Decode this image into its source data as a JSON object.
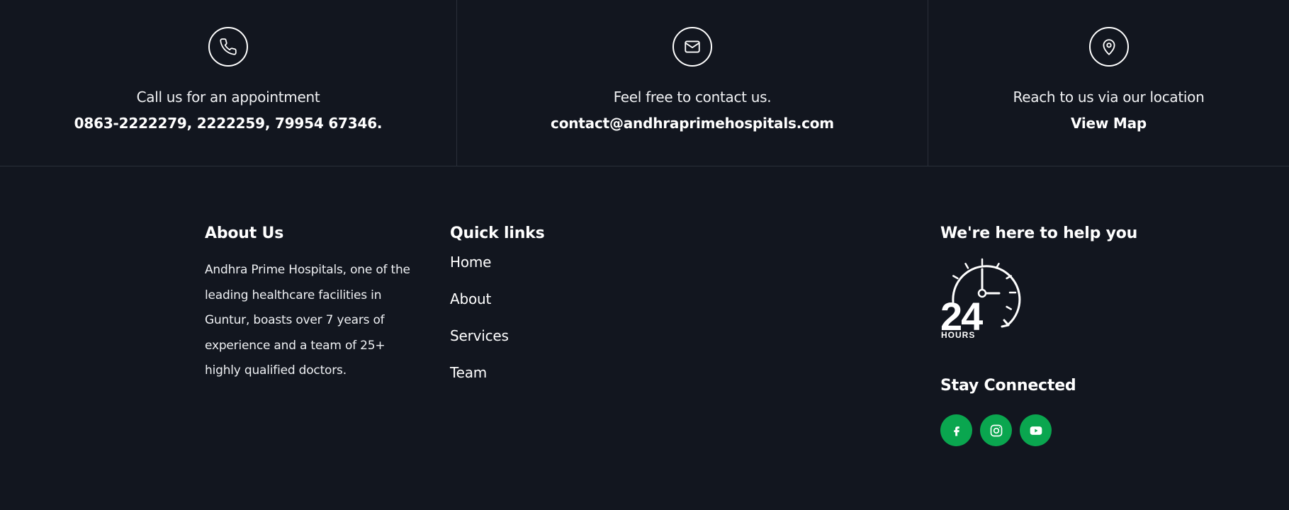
{
  "contact_bar": {
    "phone": {
      "icon": "phone-icon",
      "caption": "Call us for an appointment",
      "value": "0863-2222279, 2222259, 79954 67346."
    },
    "email": {
      "icon": "envelope-icon",
      "caption": "Feel free to contact us.",
      "value": "contact@andhraprimehospitals.com"
    },
    "location": {
      "icon": "map-pin-icon",
      "caption": "Reach to us via our location",
      "value": "View Map"
    }
  },
  "about": {
    "heading": "About Us",
    "text": "Andhra Prime Hospitals, one of the leading healthcare facilities in Guntur, boasts over 7 years of experience and a team of 25+ highly qualified doctors."
  },
  "quick_links": {
    "heading": "Quick links",
    "items": [
      {
        "label": "Home"
      },
      {
        "label": "About"
      },
      {
        "label": "Services"
      },
      {
        "label": "Team"
      }
    ]
  },
  "help": {
    "heading": "We're here to help you",
    "clock_number": "24",
    "clock_caption": "HOURS",
    "icon": "24-hours-clock-icon"
  },
  "social": {
    "heading": "Stay Connected",
    "icons": [
      "facebook-icon",
      "instagram-icon",
      "youtube-icon"
    ]
  },
  "colors": {
    "background": "#12161f",
    "divider": "#2a2f39",
    "accent_green": "#0aa64f",
    "text": "#ffffff"
  }
}
